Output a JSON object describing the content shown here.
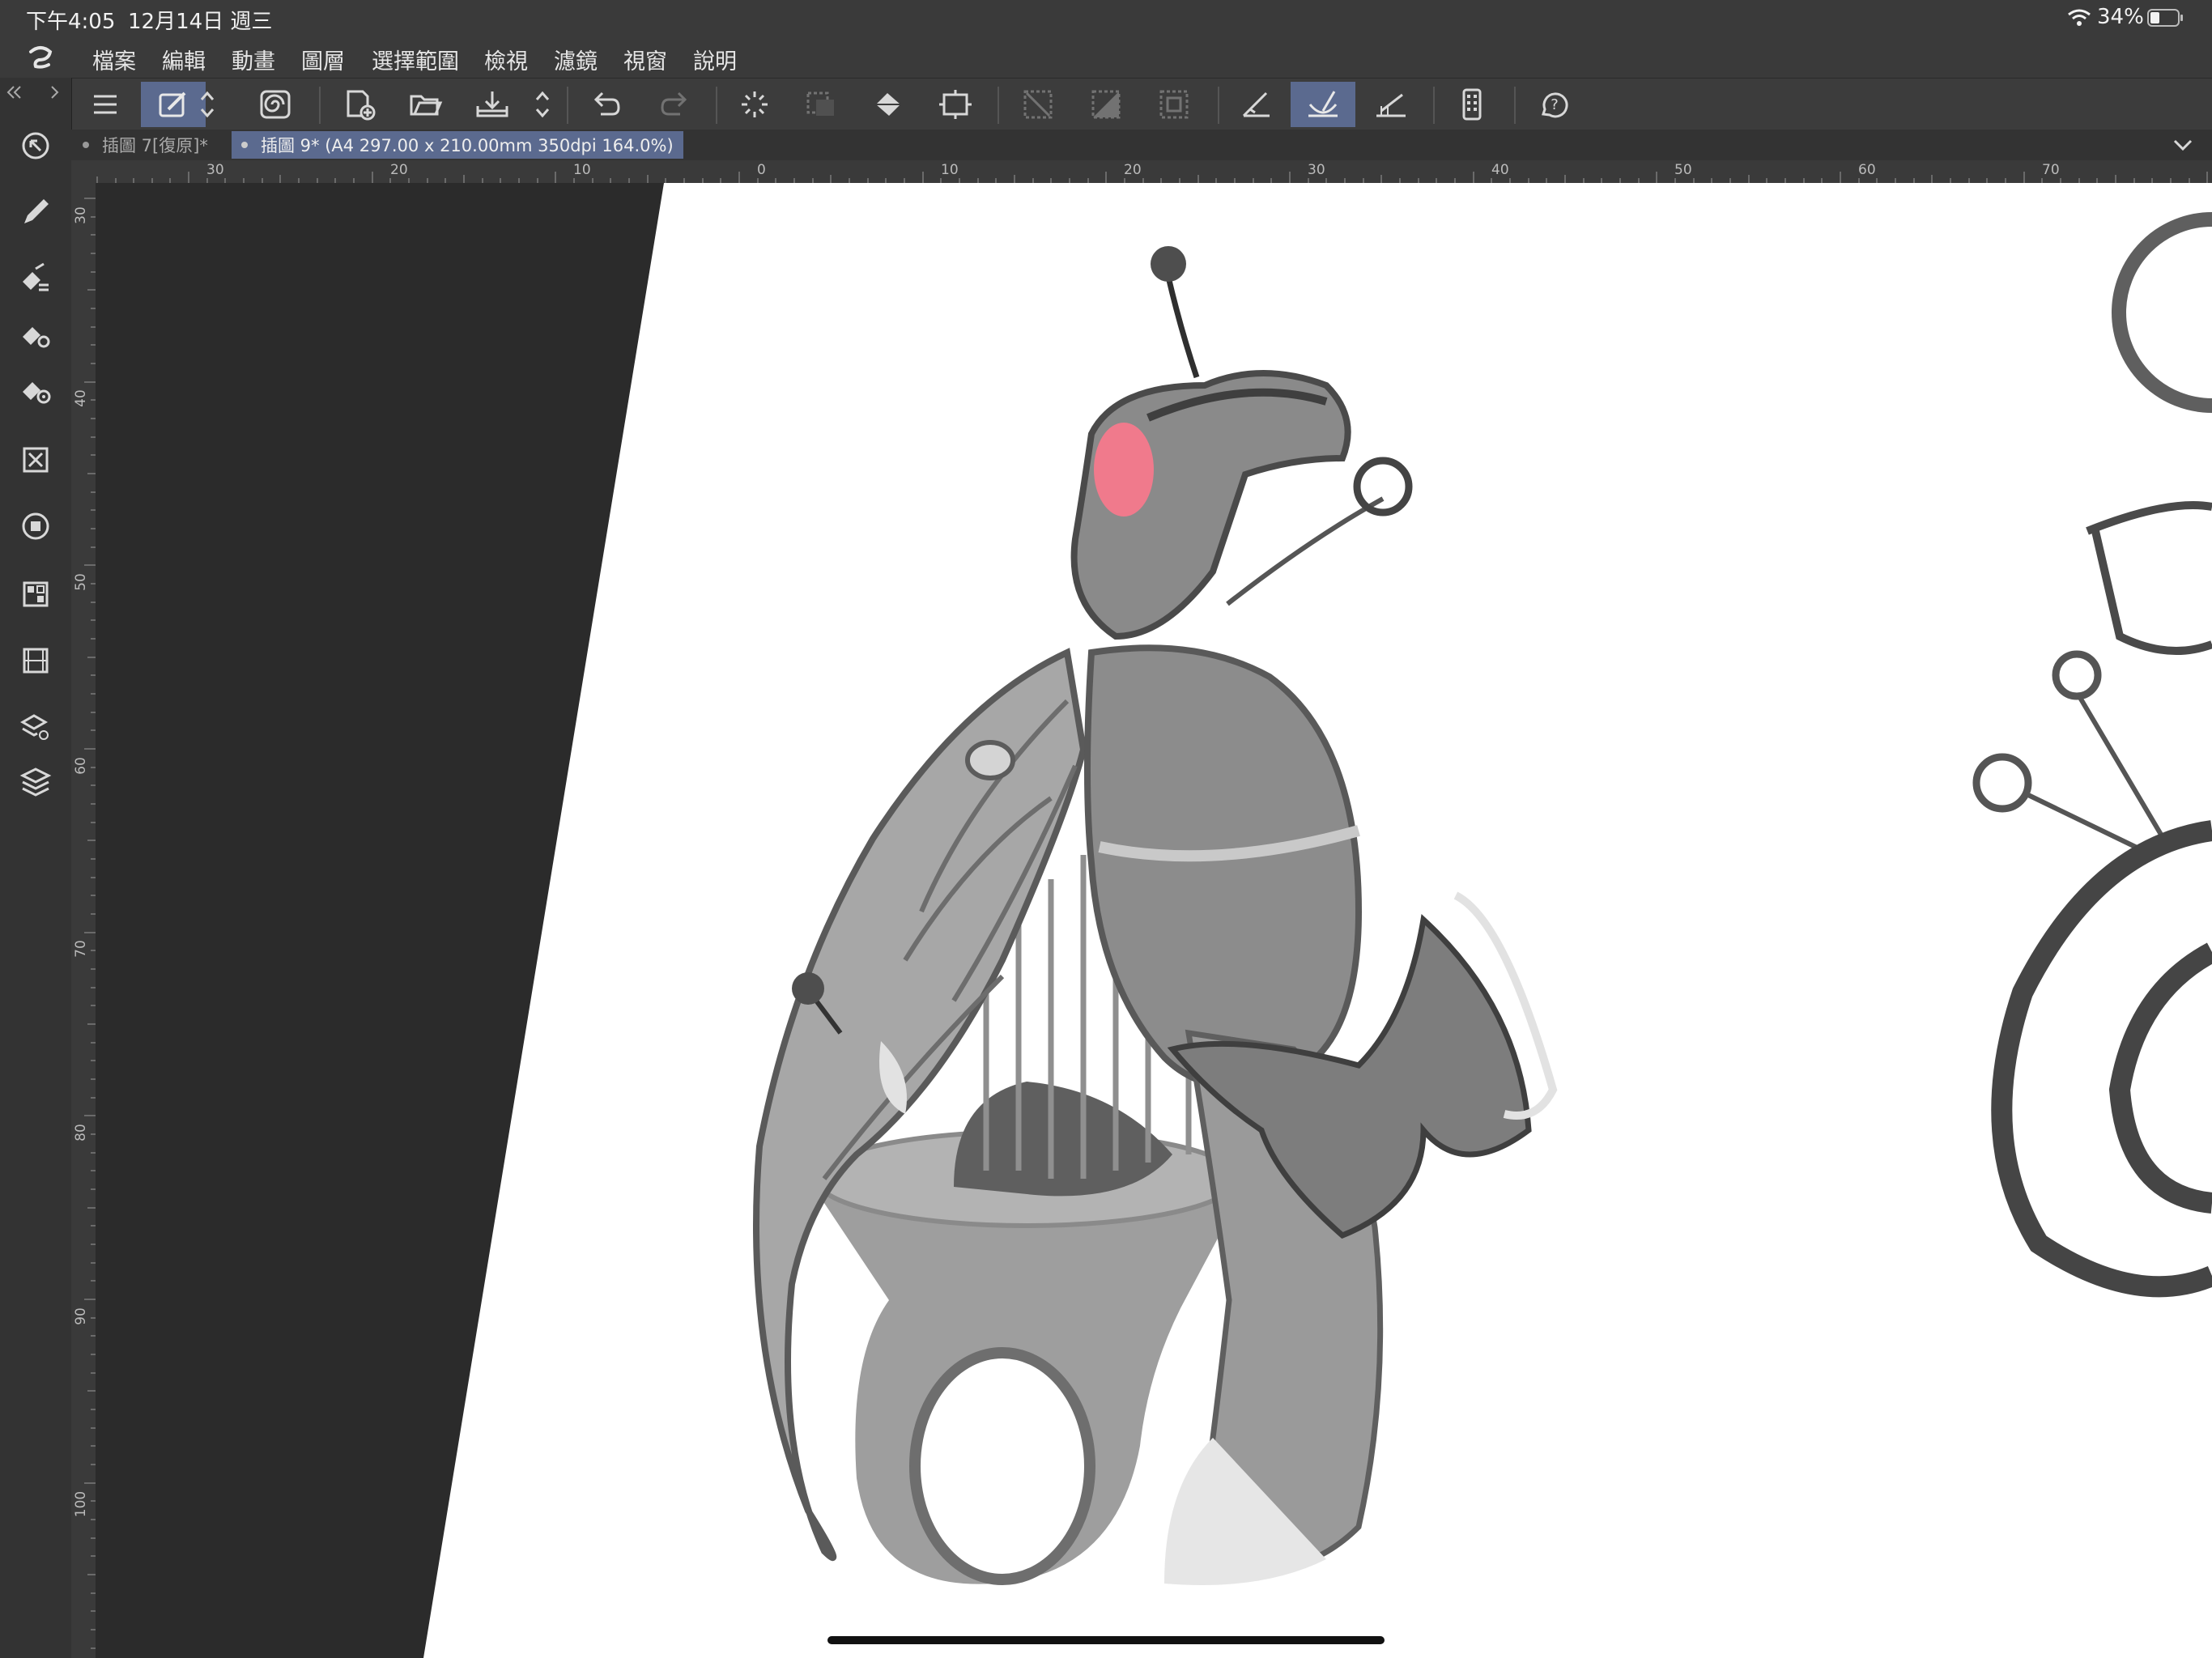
{
  "status_bar": {
    "time": "下午4:05",
    "date": "12月14日 週三",
    "battery_percent": "34%",
    "battery_level": 0.34,
    "icons": [
      "wifi-icon",
      "battery-icon"
    ]
  },
  "menu": {
    "logo_icon": "clip-studio-logo-icon",
    "items": [
      "檔案",
      "編輯",
      "動畫",
      "圖層",
      "選擇範圍",
      "檢視",
      "濾鏡",
      "視窗",
      "說明"
    ]
  },
  "toolbar": {
    "buttons": [
      {
        "icon": "hamburger-menu-icon",
        "active": false
      },
      {
        "icon": "edit-mode-icon",
        "active": true
      },
      {
        "icon": "up-down-arrows-icon",
        "active": false
      },
      {
        "icon": "spiral-brush-icon",
        "active": false
      },
      {
        "icon": "new-canvas-icon",
        "active": false
      },
      {
        "icon": "open-folder-icon",
        "active": false
      },
      {
        "icon": "save-tray-icon",
        "active": false
      },
      {
        "icon": "up-down-arrows-icon",
        "active": false
      },
      {
        "icon": "undo-icon",
        "active": false
      },
      {
        "icon": "redo-icon",
        "active": false
      },
      {
        "icon": "loading-spinner-icon",
        "active": false
      },
      {
        "icon": "selection-icon",
        "active": false
      },
      {
        "icon": "fill-bucket-icon",
        "active": false
      },
      {
        "icon": "crop-transform-icon",
        "active": false
      },
      {
        "icon": "deselect-icon",
        "active": false
      },
      {
        "icon": "invert-selection-icon",
        "active": false
      },
      {
        "icon": "selection-border-icon",
        "active": false
      },
      {
        "icon": "ruler-snap-icon",
        "active": false
      },
      {
        "icon": "special-ruler-icon",
        "active": true
      },
      {
        "icon": "grid-snap-icon",
        "active": false
      },
      {
        "icon": "companion-device-icon",
        "active": false
      },
      {
        "icon": "help-icon",
        "active": false
      }
    ]
  },
  "tabs": [
    {
      "label": "插圖 7[復原]*",
      "active": false
    },
    {
      "label": "插圖 9* (A4 297.00 x 210.00mm 350dpi 164.0%)",
      "active": true
    }
  ],
  "tab_menu_icon": "chevron-down-icon",
  "left_toolbar": {
    "collapse_icons": [
      "double-chevron-left-icon",
      "chevron-right-icon"
    ],
    "tools": [
      "zoom-move-icon",
      "pen-icon",
      "eraser-brush-icon",
      "eraser-settings-icon",
      "color-picker-icon",
      "layer-mask-icon",
      "color-wheel-icon",
      "material-palette-icon",
      "timeline-icon",
      "layer-properties-icon",
      "layers-icon"
    ]
  },
  "rulers": {
    "horizontal_labels": [
      "30",
      "20",
      "10",
      "0",
      "10",
      "20",
      "30",
      "40",
      "50",
      "60",
      "70"
    ],
    "vertical_labels": [
      "30",
      "40",
      "50",
      "60",
      "70",
      "80",
      "90",
      "100"
    ]
  },
  "colors": {
    "active_tab": "#5b6a8f",
    "panel": "#3a3a3a",
    "workspace": "#2b2b2b",
    "canvas": "#ffffff",
    "blush": "#f07a8c"
  }
}
